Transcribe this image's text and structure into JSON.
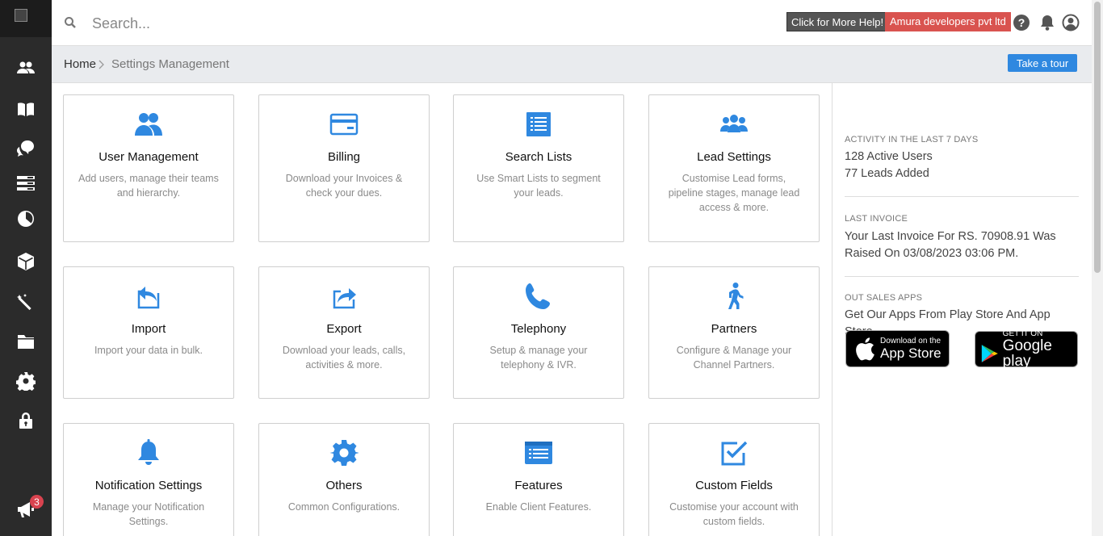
{
  "topbar": {
    "search_placeholder": "Search...",
    "help_label": "Click for More Help!",
    "company_label": "Amura developers pvt ltd"
  },
  "sidebar": {
    "items": [
      "users-icon",
      "book-icon",
      "chat-icon",
      "list-icon",
      "pie-chart-icon",
      "cube-icon",
      "magic-wand-icon",
      "folder-icon",
      "gear-icon",
      "lock-icon"
    ],
    "notification_count": "3"
  },
  "breadcrumb": {
    "home": "Home",
    "separator": ">",
    "current": "Settings Management",
    "tour_label": "Take a tour"
  },
  "cards": [
    {
      "title": "User Management",
      "desc": "Add users, manage their teams and hierarchy.",
      "icon": "users-icon"
    },
    {
      "title": "Billing",
      "desc": "Download your Invoices & check your dues.",
      "icon": "credit-card-icon"
    },
    {
      "title": "Search Lists",
      "desc": "Use Smart Lists to segment your leads.",
      "icon": "list-icon"
    },
    {
      "title": "Lead Settings",
      "desc": "Customise Lead forms, pipeline stages, manage lead access & more.",
      "icon": "group-icon"
    },
    {
      "title": "Import",
      "desc": "Import your data in bulk.",
      "icon": "import-icon"
    },
    {
      "title": "Export",
      "desc": "Download your leads, calls, activities & more.",
      "icon": "export-icon"
    },
    {
      "title": "Telephony",
      "desc": "Setup & manage your telephony & IVR.",
      "icon": "phone-icon"
    },
    {
      "title": "Partners",
      "desc": "Configure & Manage your Channel Partners.",
      "icon": "walking-person-icon"
    },
    {
      "title": "Notification Settings",
      "desc": "Manage your Notification Settings.",
      "icon": "bell-icon"
    },
    {
      "title": "Others",
      "desc": "Common Configurations.",
      "icon": "gear-icon"
    },
    {
      "title": "Features",
      "desc": "Enable Client Features.",
      "icon": "feature-list-icon"
    },
    {
      "title": "Custom Fields",
      "desc": "Customise your account with custom fields.",
      "icon": "checkbox-icon"
    }
  ],
  "right_panel": {
    "activity_label": "ACTIVITY IN THE LAST 7 DAYS",
    "active_users": "128 Active Users",
    "leads_added": "77 Leads Added",
    "invoice_label": "LAST INVOICE",
    "invoice_text": "Your Last Invoice For RS. 70908.91 Was Raised On 03/08/2023 03:06 PM.",
    "apps_label": "OUT SALES APPS",
    "apps_text": "Get Our Apps From Play Store And App Store.",
    "appstore_small": "Download on the",
    "appstore_big": "App Store",
    "playstore_small": "GET IT ON",
    "playstore_big": "Google play"
  },
  "colors": {
    "accent": "#2f88e0",
    "sidebar": "#2b2b2b",
    "danger": "#d9534f"
  }
}
